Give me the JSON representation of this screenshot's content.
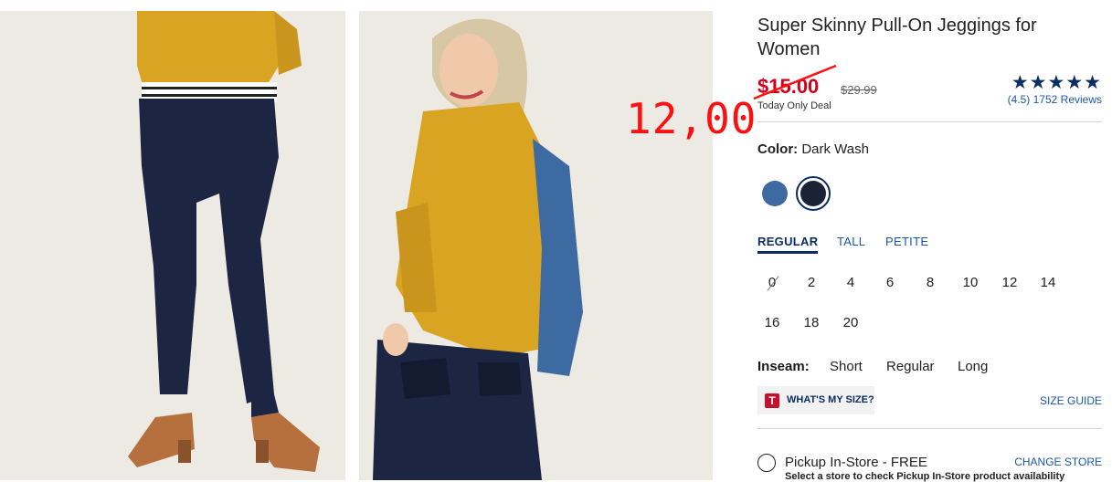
{
  "product": {
    "title": "Super Skinny Pull-On Jeggings for Women",
    "sale_price": "$15.00",
    "original_price": "$29.99",
    "deal_label": "Today Only Deal",
    "annotation_price": "12,00",
    "rating_stars": "★★★★★",
    "rating_text": "(4.5) 1752 Reviews",
    "color_label": "Color:",
    "color_value": "Dark Wash",
    "swatches": [
      "#3d6aa0",
      "#1b2238"
    ],
    "fit_tabs": [
      "REGULAR",
      "TALL",
      "PETITE"
    ],
    "sizes": [
      "0",
      "2",
      "4",
      "6",
      "8",
      "10",
      "12",
      "14",
      "16",
      "18",
      "20"
    ],
    "inseam_label": "Inseam:",
    "inseam_options": [
      "Short",
      "Regular",
      "Long"
    ],
    "whats_my_size": "WHAT'S MY SIZE?",
    "whats_my_size_logo": "T",
    "size_guide": "SIZE GUIDE",
    "pickup_label": "Pickup In-Store - FREE",
    "change_store": "CHANGE STORE",
    "pickup_note": "Select a store to check Pickup In-Store product availability"
  },
  "colors": {
    "sale_red": "#d0021b",
    "navy": "#0b2d62",
    "link": "#1d57a8"
  }
}
